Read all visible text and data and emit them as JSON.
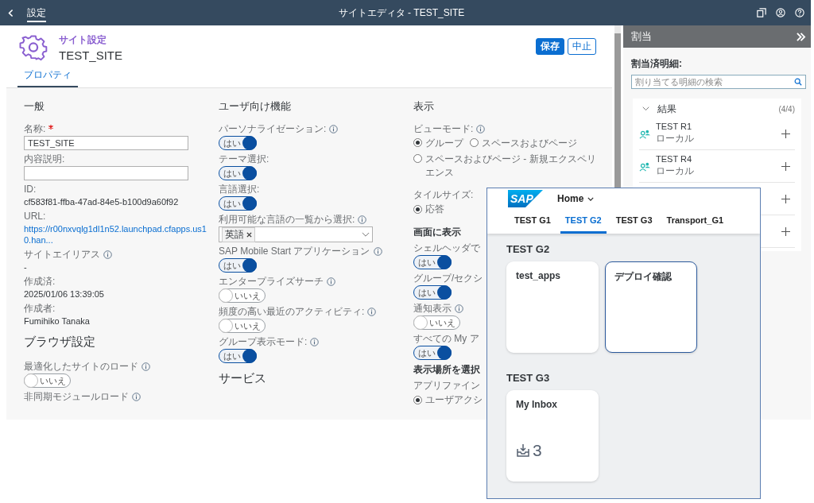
{
  "shell": {
    "nav_label": "設定",
    "title": "サイトエディタ - TEST_SITE"
  },
  "header": {
    "subtitle": "サイト設定",
    "title": "TEST_SITE",
    "buttons": [
      {
        "label": "保存",
        "kind": "primary"
      },
      {
        "label": "中止",
        "kind": "secondary"
      }
    ]
  },
  "tabs": [
    {
      "label": "プロパティ",
      "selected": true
    }
  ],
  "columns": [
    {
      "heading": "一般",
      "fields": [
        {
          "kind": "input",
          "label": "名称:",
          "required": true,
          "value": "TEST_SITE"
        },
        {
          "kind": "input",
          "label": "内容説明:"
        },
        {
          "kind": "text",
          "label": "ID:",
          "value": "cf583f81-ffba-47ad-84e5-b100d9a60f92"
        },
        {
          "kind": "link",
          "label": "URL:",
          "value": "https://r00nxvqlg1dl1n52.launchpad.cfapps.us10.han..."
        },
        {
          "kind": "text",
          "label": "サイトエイリアス",
          "info": true,
          "value": "-"
        },
        {
          "kind": "text",
          "label": "作成済:",
          "value": "2025/01/06 13:39:05"
        },
        {
          "kind": "text",
          "label": "作成者:",
          "value": "Fumihiko Tanaka"
        },
        {
          "kind": "section",
          "label": "ブラウザ設定"
        },
        {
          "kind": "toggle",
          "label": "最適化したサイトのロード",
          "info": true,
          "on": false,
          "text": "いいえ"
        },
        {
          "kind": "label",
          "label": "非同期モジュールロード",
          "info": true
        }
      ]
    },
    {
      "heading": "ユーザ向け機能",
      "fields": [
        {
          "kind": "toggle",
          "label": "パーソナライゼーション:",
          "info": true,
          "on": true,
          "text": "はい"
        },
        {
          "kind": "toggle",
          "label": "テーマ選択:",
          "on": true,
          "text": "はい"
        },
        {
          "kind": "toggle",
          "label": "言語選択:",
          "on": true,
          "text": "はい"
        },
        {
          "kind": "multiselect",
          "label": "利用可能な言語の一覧から選択:",
          "info": true,
          "tokens": [
            "英語"
          ]
        },
        {
          "kind": "toggle",
          "label": "SAP Mobile Start アプリケーション",
          "info": true,
          "on": true,
          "text": "はい"
        },
        {
          "kind": "toggle",
          "label": "エンタープライズサーチ",
          "info": true,
          "on": false,
          "text": "いいえ"
        },
        {
          "kind": "toggle",
          "label": "頻度の高い最近のアクティビティ:",
          "info": true,
          "on": false,
          "text": "いいえ"
        },
        {
          "kind": "toggle",
          "label": "グループ表示モード:",
          "info": true,
          "on": true,
          "text": "はい"
        },
        {
          "kind": "section",
          "label": "サービス"
        }
      ]
    },
    {
      "heading": "表示",
      "fields": [
        {
          "kind": "radio",
          "label": "ビューモード:",
          "info": true,
          "options": [
            {
              "label": "グループ",
              "selected": true
            },
            {
              "label": "スペースおよびページ",
              "selected": false
            },
            {
              "label": "スペースおよびページ - 新規エクスペリエンス",
              "selected": false
            }
          ]
        },
        {
          "kind": "radio",
          "label": "タイルサイズ:",
          "options": [
            {
              "label": "応答",
              "selected": true
            }
          ]
        },
        {
          "kind": "subheading",
          "label": "画面に表示"
        },
        {
          "kind": "toggle",
          "label": "シェルヘッダで",
          "on": true,
          "text": "はい"
        },
        {
          "kind": "toggle",
          "label": "グループ/セクシ",
          "on": true,
          "text": "はい"
        },
        {
          "kind": "toggle",
          "label": "通知表示",
          "info": true,
          "on": false,
          "text": "いいえ"
        },
        {
          "kind": "toggle",
          "label": "すべての My ア",
          "on": true,
          "text": "はい"
        },
        {
          "kind": "subheading",
          "label": "表示場所を選択"
        },
        {
          "kind": "radio",
          "label": "アプリファイン",
          "options": [
            {
              "label": "ユーザアクシ",
              "selected": true
            }
          ]
        }
      ]
    }
  ],
  "assignments": {
    "title": "割当",
    "assigned_label": "割当済明細:",
    "search": {
      "placeholder": "割り当てる明細の検索"
    },
    "results": {
      "label": "結果",
      "count": "(4/4)",
      "expanded": true,
      "items": [
        {
          "title": "TEST R1",
          "subtitle": "ローカル",
          "addable": true
        },
        {
          "title": "TEST R4",
          "subtitle": "ローカル",
          "addable": true
        },
        {
          "addable": true
        },
        {
          "addable": true
        }
      ]
    }
  },
  "launchpad": {
    "logo": "SAP",
    "menu": "Home",
    "tabs": [
      {
        "label": "TEST G1",
        "selected": false
      },
      {
        "label": "TEST G2",
        "selected": true
      },
      {
        "label": "TEST G3",
        "selected": false
      },
      {
        "label": "Transport_G1",
        "selected": false
      }
    ],
    "groups": [
      {
        "title": "TEST G2",
        "tiles": [
          {
            "title": "test_apps",
            "focused": false
          },
          {
            "title": "デプロイ確認",
            "focused": true
          }
        ]
      },
      {
        "title": "TEST G3",
        "tiles": [
          {
            "title": "My Inbox",
            "focused": false,
            "count": "3"
          }
        ]
      }
    ]
  }
}
